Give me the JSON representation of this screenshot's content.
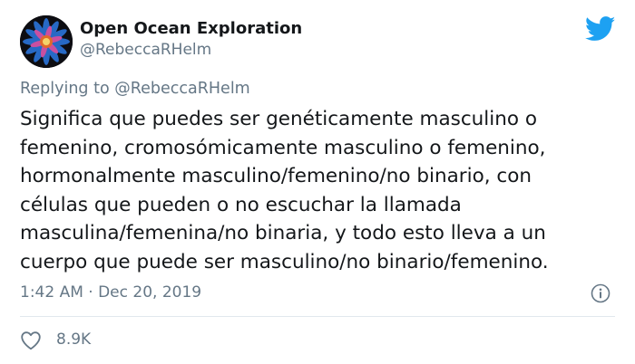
{
  "author": {
    "display_name": "Open Ocean Exploration",
    "handle": "@RebeccaRHelm",
    "avatar_icon": "sea-creature-avatar-icon"
  },
  "brand": {
    "icon": "twitter-bird-icon",
    "color": "#1da1f2"
  },
  "reply": {
    "prefix": "Replying to",
    "mention": "@RebeccaRHelm"
  },
  "body": {
    "lines": [
      "Significa que puedes ser genéticamente masculino o",
      "femenino, cromosómicamente masculino o femenino,",
      "hormonalmente masculino/femenino/no binario, con",
      "células que pueden o no escuchar la llamada",
      "masculina/femenina/no binaria, y todo esto lleva a un",
      "cuerpo que puede ser masculino/no binario/femenino."
    ]
  },
  "meta": {
    "timestamp": "1:42 AM · Dec 20, 2019",
    "info_icon": "info-icon"
  },
  "engagement": {
    "like_icon": "heart-icon",
    "likes": "8.9K"
  },
  "colors": {
    "text": "#14171a",
    "secondary": "#657786",
    "divider": "#e1e8ed"
  }
}
